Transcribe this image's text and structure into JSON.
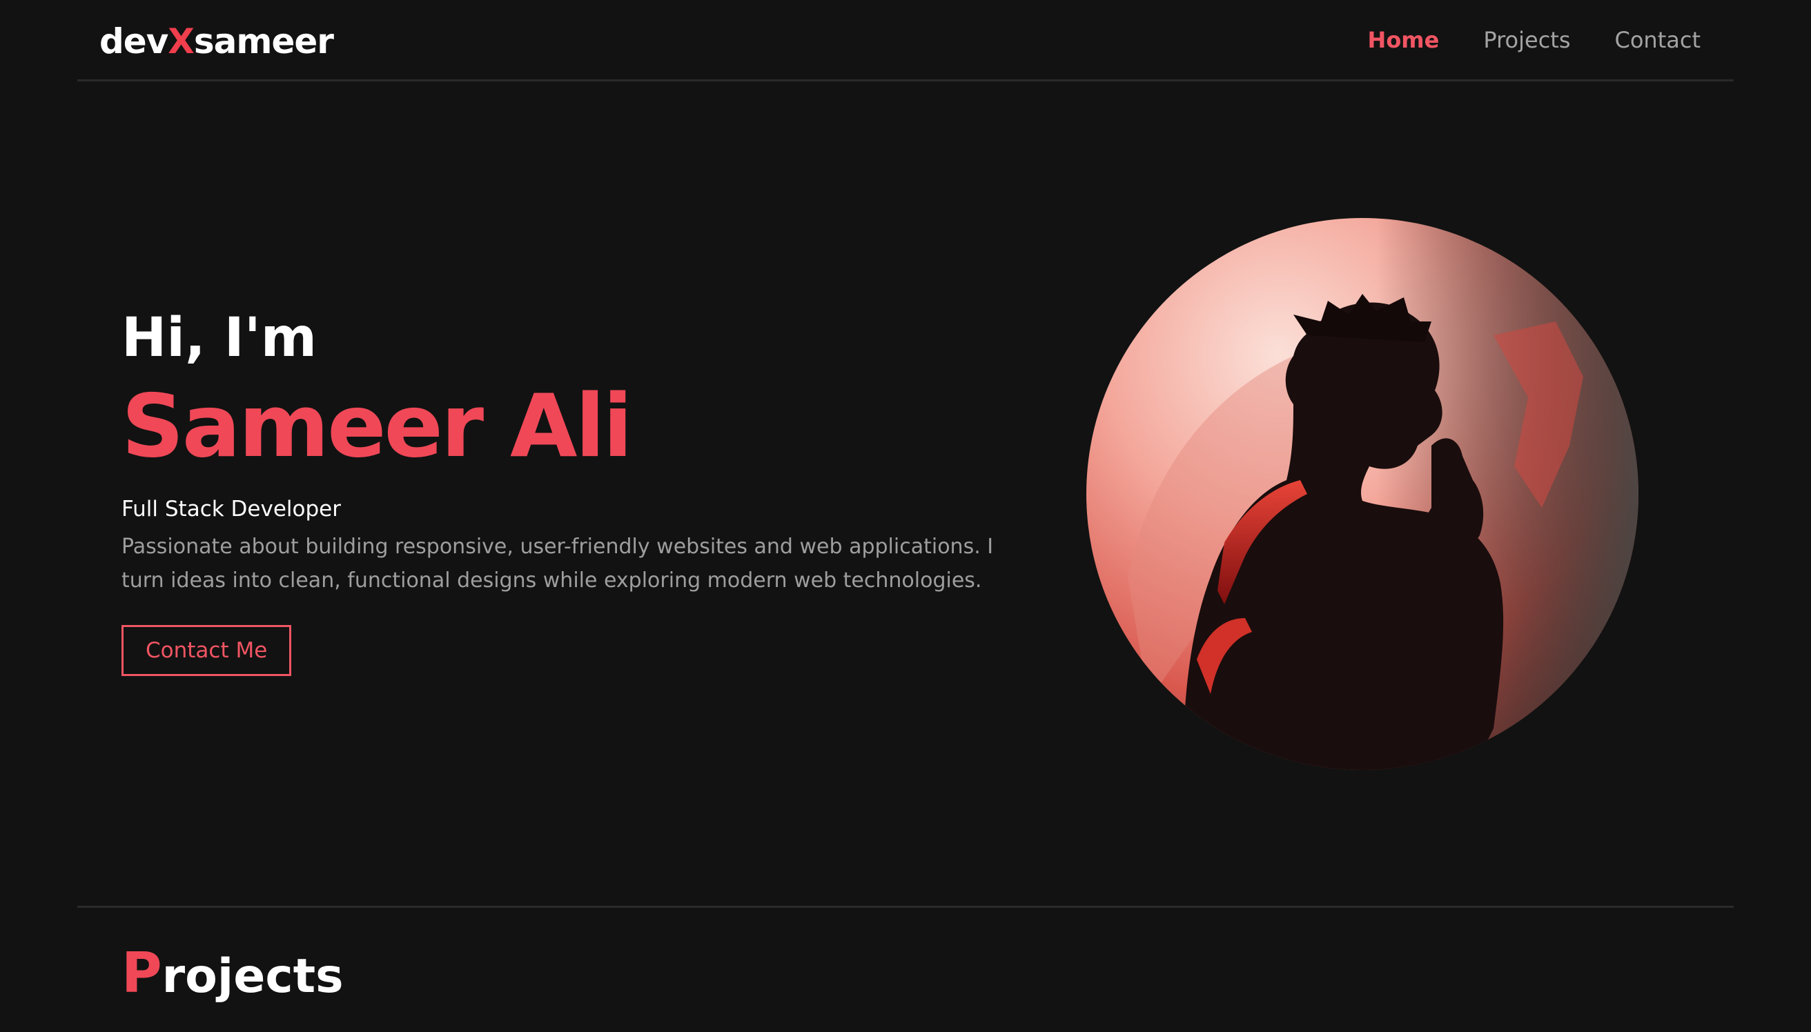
{
  "header": {
    "logo_prefix": "dev",
    "logo_accent": "X",
    "logo_suffix": "sameer",
    "nav": [
      {
        "label": "Home",
        "active": true
      },
      {
        "label": "Projects",
        "active": false
      },
      {
        "label": "Contact",
        "active": false
      }
    ]
  },
  "hero": {
    "greeting": "Hi, I'm",
    "name": "Sameer Ali",
    "role": "Full Stack Developer",
    "bio": "Passionate about building responsive, user-friendly websites and web applications. I turn ideas into clean, functional designs while exploring modern web technologies.",
    "cta_label": "Contact Me"
  },
  "projects": {
    "heading_first_letter": "P",
    "heading_rest": "rojects"
  },
  "colors": {
    "background": "#121212",
    "accent": "#f04857",
    "divider": "#2a2a2a",
    "muted_text": "#9e9e9e"
  },
  "icons": {
    "portrait": "anime-silhouette-avatar"
  }
}
